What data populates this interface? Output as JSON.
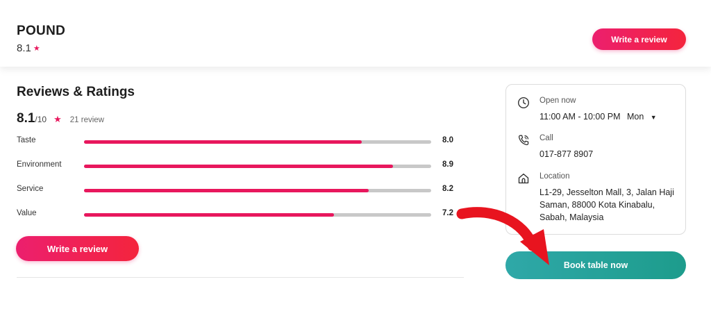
{
  "header": {
    "business_name": "POUND",
    "rating": "8.1",
    "write_review_label": "Write a review"
  },
  "reviews": {
    "title": "Reviews & Ratings",
    "score": "8.1",
    "out_of": "/10",
    "count_text": "21 review",
    "categories": [
      {
        "label": "Taste",
        "value": "8.0",
        "fraction": 0.8
      },
      {
        "label": "Environment",
        "value": "8.9",
        "fraction": 0.89
      },
      {
        "label": "Service",
        "value": "8.2",
        "fraction": 0.82
      },
      {
        "label": "Value",
        "value": "7.2",
        "fraction": 0.72
      }
    ],
    "write_review_label": "Write a review"
  },
  "info": {
    "hours_label": "Open now",
    "hours_value": "11:00 AM - 10:00 PM",
    "hours_day": "Mon",
    "call_label": "Call",
    "call_value": "017-877 8907",
    "location_label": "Location",
    "location_value": "L1-29, Jesselton Mall, 3, Jalan Haji Saman, 88000 Kota Kinabalu, Sabah, Malaysia"
  },
  "book_label": "Book table now",
  "colors": {
    "accent": "#e8175d",
    "book_button": "#23a197",
    "bar_track": "#c8c8c8",
    "arrow": "#e8141f"
  }
}
